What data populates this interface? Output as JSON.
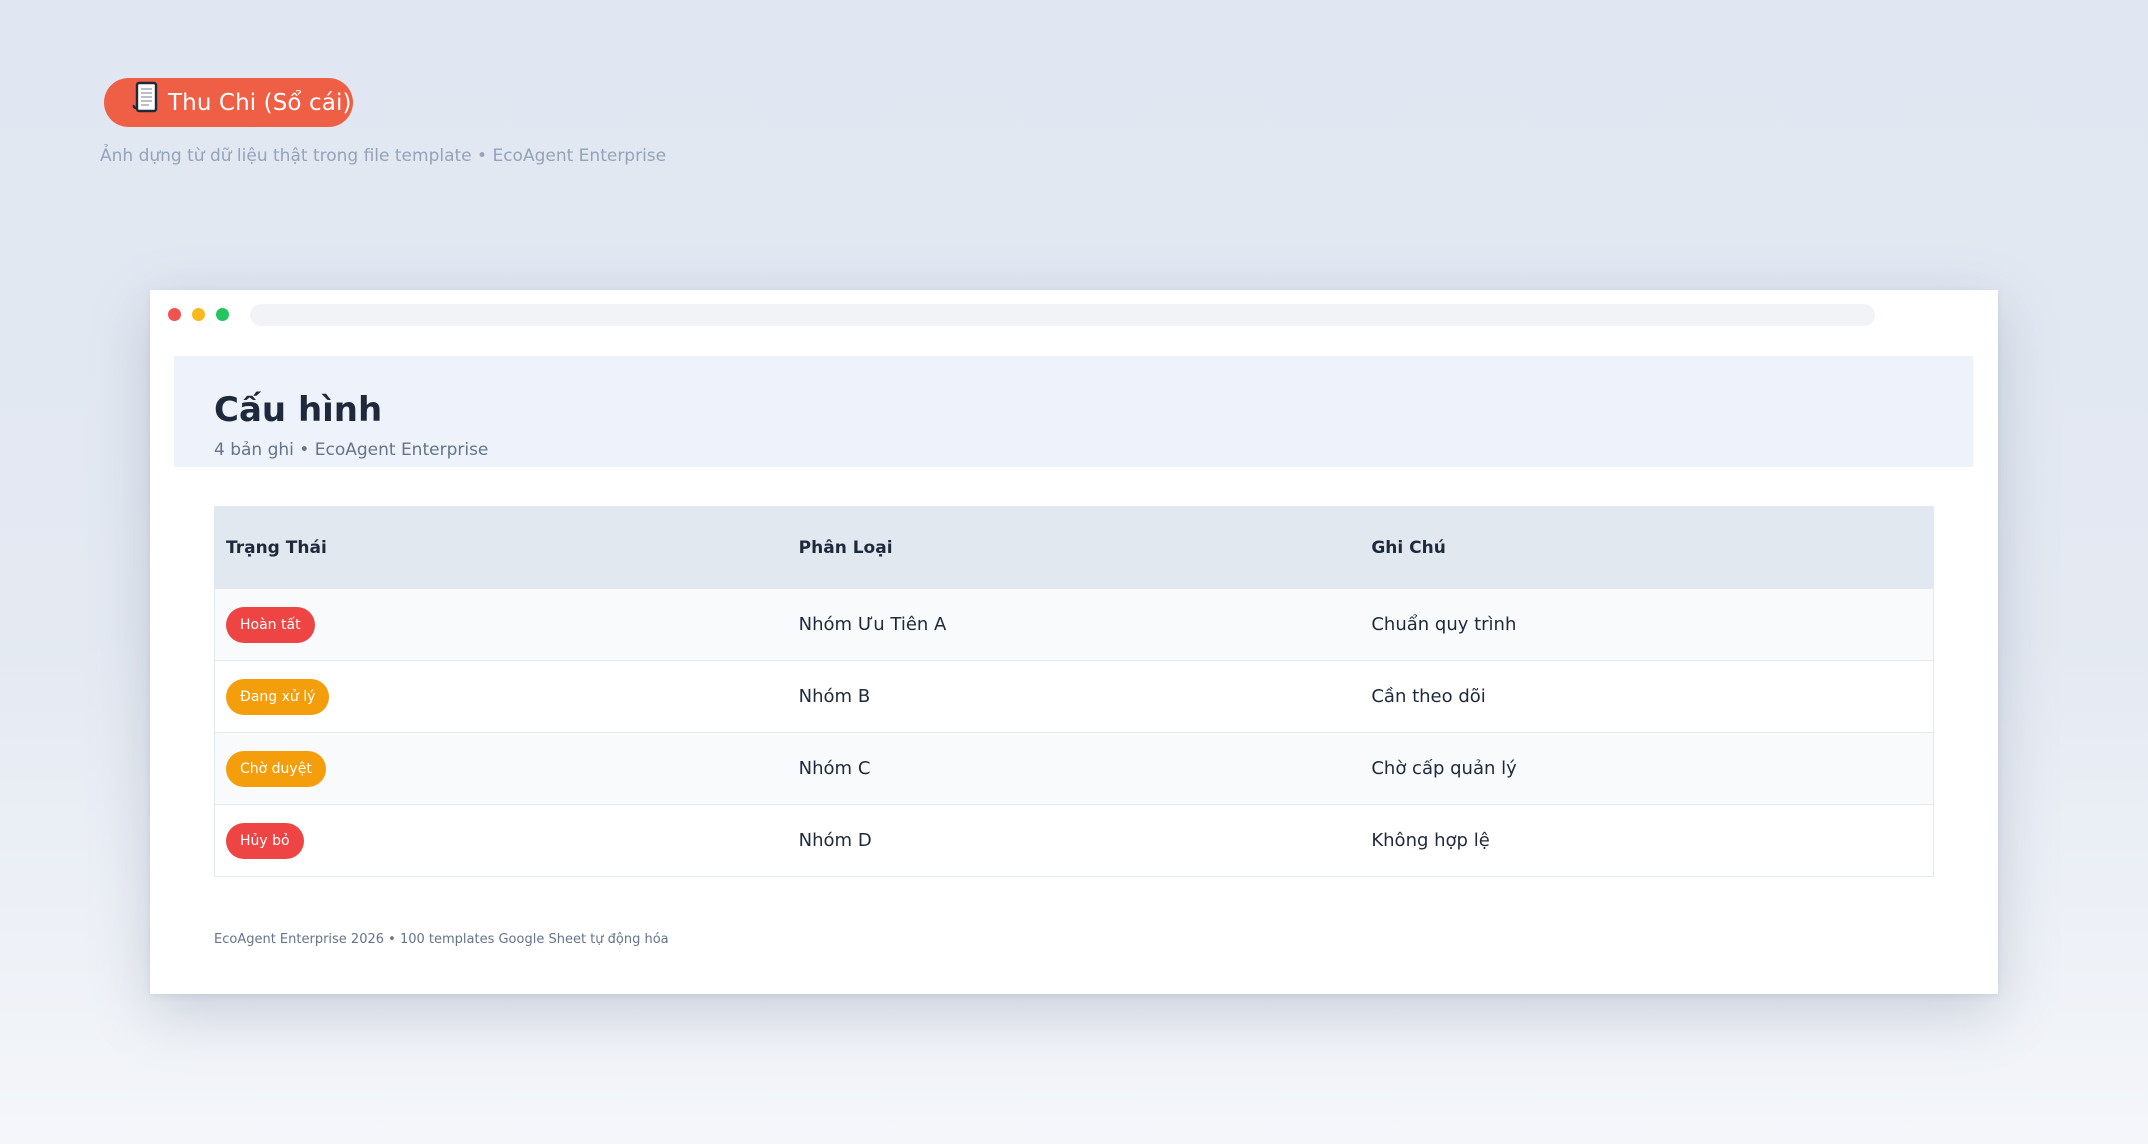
{
  "badge": {
    "icon": "scroll-icon",
    "label": "Thu Chi (Sổ cái)",
    "color": "#ef5f45"
  },
  "caption": "Ảnh dựng từ dữ liệu thật trong file template • EcoAgent Enterprise",
  "page": {
    "title": "Cấu hình",
    "subtitle": "4 bản ghi • EcoAgent Enterprise"
  },
  "table": {
    "columns": [
      "Trạng Thái",
      "Phân Loại",
      "Ghi Chú"
    ],
    "rows": [
      {
        "status": "Hoàn tất",
        "status_color": "#ef4444",
        "category": "Nhóm Ưu Tiên A",
        "note": "Chuẩn quy trình"
      },
      {
        "status": "Đang xử lý",
        "status_color": "#f59e0b",
        "category": "Nhóm B",
        "note": "Cần theo dõi"
      },
      {
        "status": "Chờ duyệt",
        "status_color": "#f59e0b",
        "category": "Nhóm C",
        "note": "Chờ cấp quản lý"
      },
      {
        "status": "Hủy bỏ",
        "status_color": "#ef4444",
        "category": "Nhóm D",
        "note": "Không hợp lệ"
      }
    ]
  },
  "footer": "EcoAgent Enterprise 2026 • 100 templates Google Sheet tự động hóa"
}
